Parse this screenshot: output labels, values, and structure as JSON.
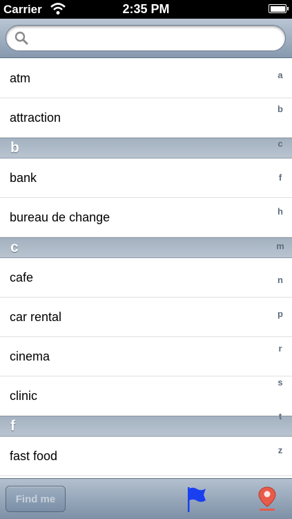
{
  "status_bar": {
    "carrier": "Carrier",
    "time": "2:35 PM",
    "icons": [
      "wifi-icon",
      "battery-icon"
    ]
  },
  "search": {
    "placeholder": "",
    "value": "",
    "icon": "search-icon"
  },
  "list": {
    "entries": [
      {
        "kind": "row",
        "label": "atm"
      },
      {
        "kind": "row",
        "label": "attraction"
      },
      {
        "kind": "section",
        "label": "b"
      },
      {
        "kind": "row",
        "label": "bank"
      },
      {
        "kind": "row",
        "label": "bureau de change"
      },
      {
        "kind": "section",
        "label": "c"
      },
      {
        "kind": "row",
        "label": "cafe"
      },
      {
        "kind": "row",
        "label": "car rental"
      },
      {
        "kind": "row",
        "label": "cinema"
      },
      {
        "kind": "row",
        "label": "clinic"
      },
      {
        "kind": "section",
        "label": "f"
      },
      {
        "kind": "row",
        "label": "fast food"
      }
    ]
  },
  "index": [
    "a",
    "b",
    "c",
    "f",
    "h",
    "m",
    "n",
    "p",
    "r",
    "s",
    "t",
    "z"
  ],
  "toolbar": {
    "find_me_label": "Find me",
    "icons": [
      "flag-icon",
      "map-pin-icon"
    ]
  },
  "colors": {
    "bar_top": "#b9c5d3",
    "bar_bottom": "#7d90a6",
    "section_header": "#a3b1c0",
    "flag_blue": "#1a3ff0",
    "pin_red": "#e85a4a",
    "index_text": "#5f6c7d"
  }
}
